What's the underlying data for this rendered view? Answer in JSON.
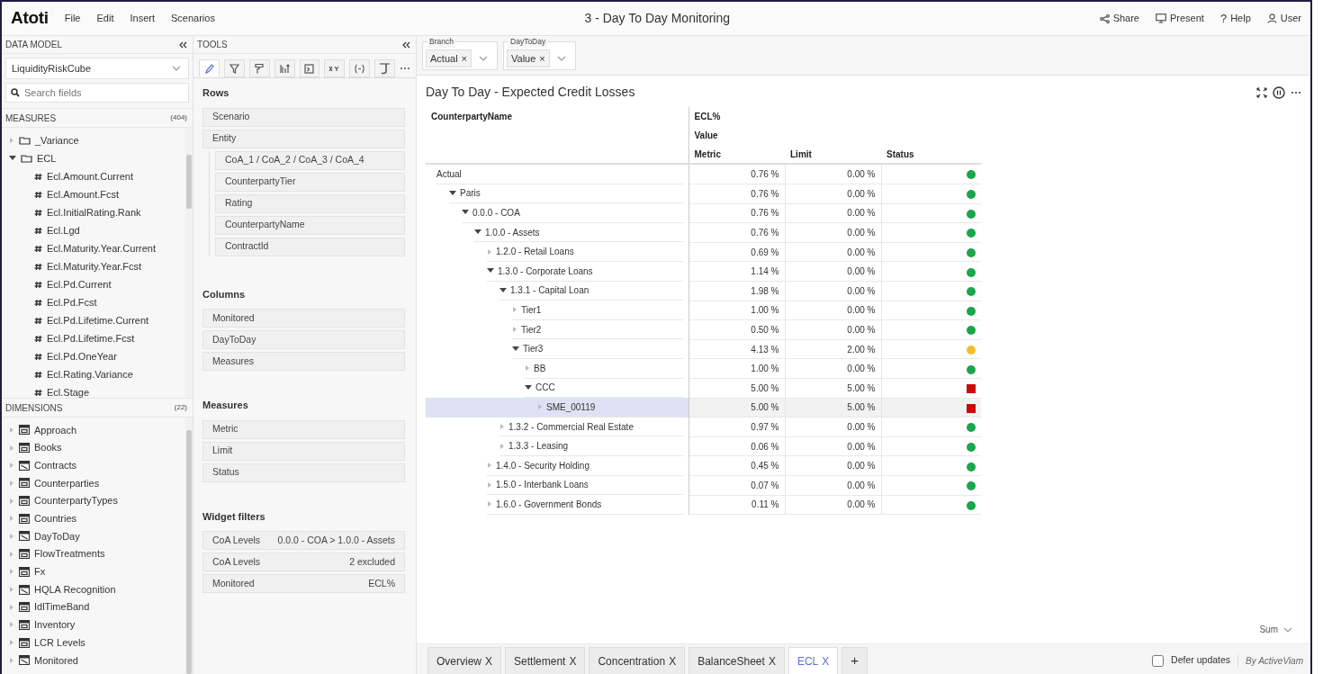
{
  "app": {
    "logo": "Atoti",
    "menu": [
      "File",
      "Edit",
      "Insert",
      "Scenarios"
    ],
    "title": "3 - Day To Day Monitoring",
    "actions": [
      {
        "kind": "share",
        "label": "Share"
      },
      {
        "kind": "present",
        "label": "Present"
      },
      {
        "kind": "help",
        "icon": "?",
        "label": "Help"
      },
      {
        "kind": "user",
        "label": "User"
      }
    ]
  },
  "data_model": {
    "header": "DATA MODEL",
    "cube": "LiquidityRiskCube",
    "search": {
      "placeholder": "Search fields"
    },
    "measures": {
      "header": "MEASURES",
      "count": "(404)",
      "items": [
        {
          "label": "_Variance",
          "kind": "folder",
          "expanded": false
        },
        {
          "label": "ECL",
          "kind": "folder",
          "expanded": true,
          "children": [
            {
              "label": "Ecl.Amount.Current",
              "kind": "measure"
            },
            {
              "label": "Ecl.Amount.Fcst",
              "kind": "measure"
            },
            {
              "label": "Ecl.InitialRating.Rank",
              "kind": "measure"
            },
            {
              "label": "Ecl.Lgd",
              "kind": "measure"
            },
            {
              "label": "Ecl.Maturity.Year.Current",
              "kind": "measure"
            },
            {
              "label": "Ecl.Maturity.Year.Fcst",
              "kind": "measure"
            },
            {
              "label": "Ecl.Pd.Current",
              "kind": "measure"
            },
            {
              "label": "Ecl.Pd.Fcst",
              "kind": "measure"
            },
            {
              "label": "Ecl.Pd.Lifetime.Current",
              "kind": "measure"
            },
            {
              "label": "Ecl.Pd.Lifetime.Fcst",
              "kind": "measure"
            },
            {
              "label": "Ecl.Pd.OneYear",
              "kind": "measure"
            },
            {
              "label": "Ecl.Rating.Variance",
              "kind": "measure"
            },
            {
              "label": "Ecl.Stage",
              "kind": "measure"
            }
          ]
        }
      ]
    },
    "dimensions": {
      "header": "DIMENSIONS",
      "count": "(22)",
      "items": [
        {
          "label": "Approach",
          "kind": "standard"
        },
        {
          "label": "Books",
          "kind": "standard"
        },
        {
          "label": "Contracts",
          "kind": "slicing"
        },
        {
          "label": "Counterparties",
          "kind": "standard"
        },
        {
          "label": "CounterpartyTypes",
          "kind": "standard"
        },
        {
          "label": "Countries",
          "kind": "standard"
        },
        {
          "label": "DayToDay",
          "kind": "slicing"
        },
        {
          "label": "FlowTreatments",
          "kind": "standard"
        },
        {
          "label": "Fx",
          "kind": "standard"
        },
        {
          "label": "HQLA Recognition",
          "kind": "slicing"
        },
        {
          "label": "IdlTimeBand",
          "kind": "standard"
        },
        {
          "label": "Inventory",
          "kind": "standard"
        },
        {
          "label": "LCR Levels",
          "kind": "standard"
        },
        {
          "label": "Monitored",
          "kind": "slicing"
        }
      ]
    }
  },
  "tools": {
    "header": "TOOLS",
    "tabs": [
      {
        "kind": "pencil",
        "selected": true
      },
      {
        "kind": "filter",
        "selected": false
      },
      {
        "kind": "paint",
        "selected": false
      },
      {
        "kind": "sort",
        "selected": false
      },
      {
        "kind": "format",
        "selected": false
      },
      {
        "kind": "xy",
        "selected": false
      },
      {
        "kind": "braces",
        "selected": false
      },
      {
        "kind": "partial",
        "selected": false
      }
    ],
    "sections": [
      {
        "title": "Rows",
        "items": [
          {
            "label": "Scenario"
          },
          {
            "label": "Entity",
            "children": [
              {
                "label": "CoA_1 / CoA_2 / CoA_3 / CoA_4"
              },
              {
                "label": "CounterpartyTier"
              },
              {
                "label": "Rating"
              },
              {
                "label": "CounterpartyName"
              },
              {
                "label": "ContractId"
              }
            ]
          }
        ]
      },
      {
        "title": "Columns",
        "items": [
          {
            "label": "Monitored"
          },
          {
            "label": "DayToDay"
          },
          {
            "label": "Measures"
          }
        ]
      },
      {
        "title": "Measures",
        "items": [
          {
            "label": "Metric"
          },
          {
            "label": "Limit"
          },
          {
            "label": "Status"
          }
        ]
      },
      {
        "title": "Widget filters",
        "items": [
          {
            "label": "CoA Levels",
            "value": "0.0.0 - COA > 1.0.0 - Assets"
          },
          {
            "label": "CoA Levels",
            "value": "2 excluded"
          },
          {
            "label": "Monitored",
            "value": "ECL%"
          }
        ]
      }
    ]
  },
  "filters": [
    {
      "label": "Branch",
      "value": "Actual",
      "remove": "×"
    },
    {
      "label": "DayToDay",
      "value": "Value",
      "remove": "×"
    }
  ],
  "widget": {
    "title": "Day To Day - Expected Credit Losses",
    "table": {
      "row_header": "CounterpartyName",
      "column_levels": [
        "ECL%",
        "Value"
      ],
      "columns": [
        "Metric",
        "Limit",
        "Status"
      ],
      "rows": [
        {
          "label": "Actual",
          "kind": "plain",
          "selected": false,
          "metric": "0.76 %",
          "limit": "0.00 %",
          "status": {
            "kind": "dot",
            "color": "#1aa64a"
          },
          "children": [
            {
              "label": "Paris",
              "kind": "node",
              "expanded": true,
              "selected": false,
              "metric": "0.76 %",
              "limit": "0.00 %",
              "status": {
                "kind": "dot",
                "color": "#1aa64a"
              },
              "children": [
                {
                  "label": "0.0.0 - COA",
                  "kind": "node",
                  "expanded": true,
                  "selected": false,
                  "metric": "0.76 %",
                  "limit": "0.00 %",
                  "status": {
                    "kind": "dot",
                    "color": "#1aa64a"
                  },
                  "children": [
                    {
                      "label": "1.0.0 - Assets",
                      "kind": "node",
                      "expanded": true,
                      "selected": false,
                      "metric": "0.76 %",
                      "limit": "0.00 %",
                      "status": {
                        "kind": "dot",
                        "color": "#1aa64a"
                      },
                      "children": [
                        {
                          "label": "1.2.0 - Retail Loans",
                          "kind": "node",
                          "expanded": false,
                          "selected": false,
                          "metric": "0.69 %",
                          "limit": "0.00 %",
                          "status": {
                            "kind": "dot",
                            "color": "#1aa64a"
                          }
                        },
                        {
                          "label": "1.3.0 - Corporate Loans",
                          "kind": "node",
                          "expanded": true,
                          "selected": false,
                          "metric": "1.14 %",
                          "limit": "0.00 %",
                          "status": {
                            "kind": "dot",
                            "color": "#1aa64a"
                          },
                          "children": [
                            {
                              "label": "1.3.1 - Capital Loan",
                              "kind": "node",
                              "expanded": true,
                              "selected": false,
                              "metric": "1.98 %",
                              "limit": "0.00 %",
                              "status": {
                                "kind": "dot",
                                "color": "#1aa64a"
                              },
                              "children": [
                                {
                                  "label": "Tier1",
                                  "kind": "node",
                                  "expanded": false,
                                  "selected": false,
                                  "metric": "1.00 %",
                                  "limit": "0.00 %",
                                  "status": {
                                    "kind": "dot",
                                    "color": "#1aa64a"
                                  }
                                },
                                {
                                  "label": "Tier2",
                                  "kind": "node",
                                  "expanded": false,
                                  "selected": false,
                                  "metric": "0.50 %",
                                  "limit": "0.00 %",
                                  "status": {
                                    "kind": "dot",
                                    "color": "#1aa64a"
                                  }
                                },
                                {
                                  "label": "Tier3",
                                  "kind": "node",
                                  "expanded": true,
                                  "selected": false,
                                  "metric": "4.13 %",
                                  "limit": "2.00 %",
                                  "status": {
                                    "kind": "dot",
                                    "color": "#f0c02c"
                                  },
                                  "children": [
                                    {
                                      "label": "BB",
                                      "kind": "node",
                                      "expanded": false,
                                      "selected": false,
                                      "metric": "1.00 %",
                                      "limit": "0.00 %",
                                      "status": {
                                        "kind": "dot",
                                        "color": "#1aa64a"
                                      }
                                    },
                                    {
                                      "label": "CCC",
                                      "kind": "node",
                                      "expanded": true,
                                      "selected": false,
                                      "metric": "5.00 %",
                                      "limit": "5.00 %",
                                      "status": {
                                        "kind": "square",
                                        "color": "#cc0a0a"
                                      },
                                      "children": [
                                        {
                                          "label": "SME_00119",
                                          "kind": "node",
                                          "expanded": false,
                                          "selected": true,
                                          "metric": "5.00 %",
                                          "limit": "5.00 %",
                                          "status": {
                                            "kind": "square",
                                            "color": "#cc0a0a"
                                          }
                                        }
                                      ]
                                    }
                                  ]
                                }
                              ]
                            },
                            {
                              "label": "1.3.2 - Commercial Real Estate",
                              "kind": "node",
                              "expanded": false,
                              "selected": false,
                              "metric": "0.97 %",
                              "limit": "0.00 %",
                              "status": {
                                "kind": "dot",
                                "color": "#1aa64a"
                              }
                            },
                            {
                              "label": "1.3.3 - Leasing",
                              "kind": "node",
                              "expanded": false,
                              "selected": false,
                              "metric": "0.06 %",
                              "limit": "0.00 %",
                              "status": {
                                "kind": "dot",
                                "color": "#1aa64a"
                              }
                            }
                          ]
                        },
                        {
                          "label": "1.4.0 - Security Holding",
                          "kind": "node",
                          "expanded": false,
                          "selected": false,
                          "metric": "0.45 %",
                          "limit": "0.00 %",
                          "status": {
                            "kind": "dot",
                            "color": "#1aa64a"
                          }
                        },
                        {
                          "label": "1.5.0 - Interbank Loans",
                          "kind": "node",
                          "expanded": false,
                          "selected": false,
                          "metric": "0.07 %",
                          "limit": "0.00 %",
                          "status": {
                            "kind": "dot",
                            "color": "#1aa64a"
                          }
                        },
                        {
                          "label": "1.6.0 - Government Bonds",
                          "kind": "node",
                          "expanded": false,
                          "selected": false,
                          "metric": "0.11 %",
                          "limit": "0.00 %",
                          "status": {
                            "kind": "dot",
                            "color": "#1aa64a"
                          }
                        }
                      ]
                    }
                  ]
                }
              ]
            }
          ]
        }
      ]
    },
    "aggregation": "Sum"
  },
  "pages": [
    {
      "label": "Overview",
      "close": "X",
      "selected": false
    },
    {
      "label": "Settlement",
      "close": "X",
      "selected": false
    },
    {
      "label": "Concentration",
      "close": "X",
      "selected": false
    },
    {
      "label": "BalanceSheet",
      "close": "X",
      "selected": false
    },
    {
      "label": "ECL",
      "close": "X",
      "selected": true
    }
  ],
  "add_page": "+",
  "defer_updates": {
    "label": "Defer updates",
    "checked": false
  },
  "credit": "By ActiveViam"
}
